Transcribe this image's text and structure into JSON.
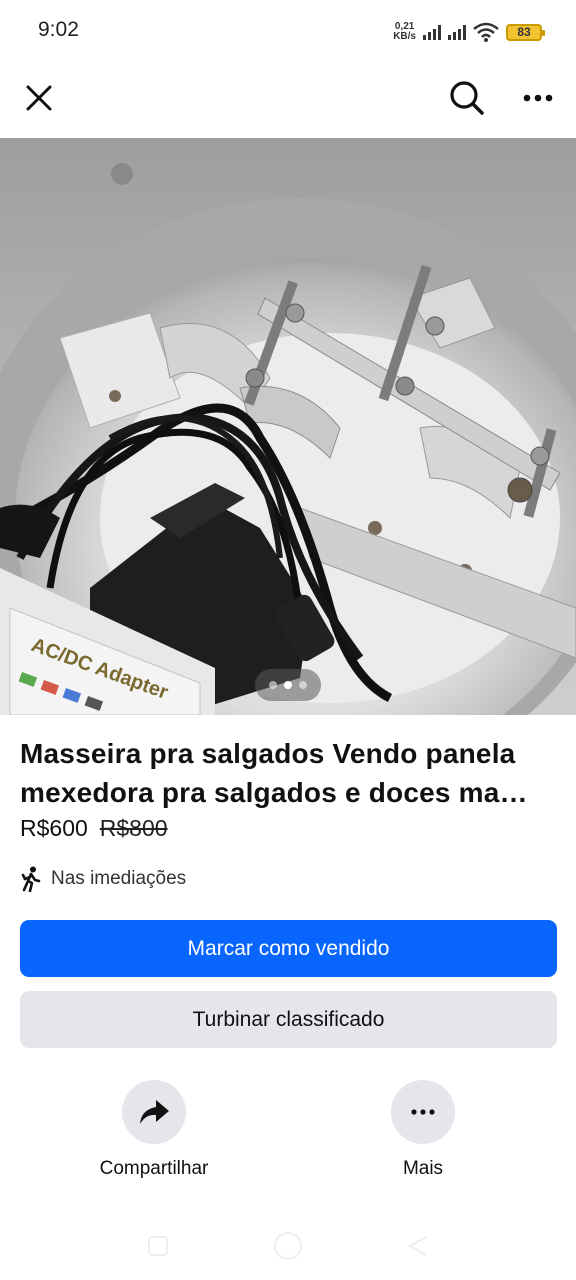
{
  "status_bar": {
    "time": "9:02",
    "net_speed_value": "0,21",
    "net_speed_unit": "KB/s",
    "battery": "83",
    "battery_color": "#f2c230"
  },
  "nav": {
    "close_icon": "close-icon",
    "search_icon": "search-icon",
    "more_icon": "more-horizontal-icon"
  },
  "photo": {
    "label_text": "AC/DC Adapter",
    "pager": {
      "count": 3,
      "active_index": 1
    }
  },
  "listing": {
    "title": "Masseira pra salgados Vendo panela mexedora pra salgados e doces ma…",
    "price": "R$600",
    "old_price": "R$800",
    "location": "Nas imediações",
    "location_icon": "walking-person-icon"
  },
  "buttons": {
    "mark_sold": "Marcar como vendido",
    "boost": "Turbinar classificado"
  },
  "actions": {
    "share_label": "Compartilhar",
    "share_icon": "share-arrow-icon",
    "more_label": "Mais",
    "more_icon": "more-horizontal-icon"
  },
  "colors": {
    "primary": "#0866ff",
    "secondary": "#e4e6eb"
  }
}
